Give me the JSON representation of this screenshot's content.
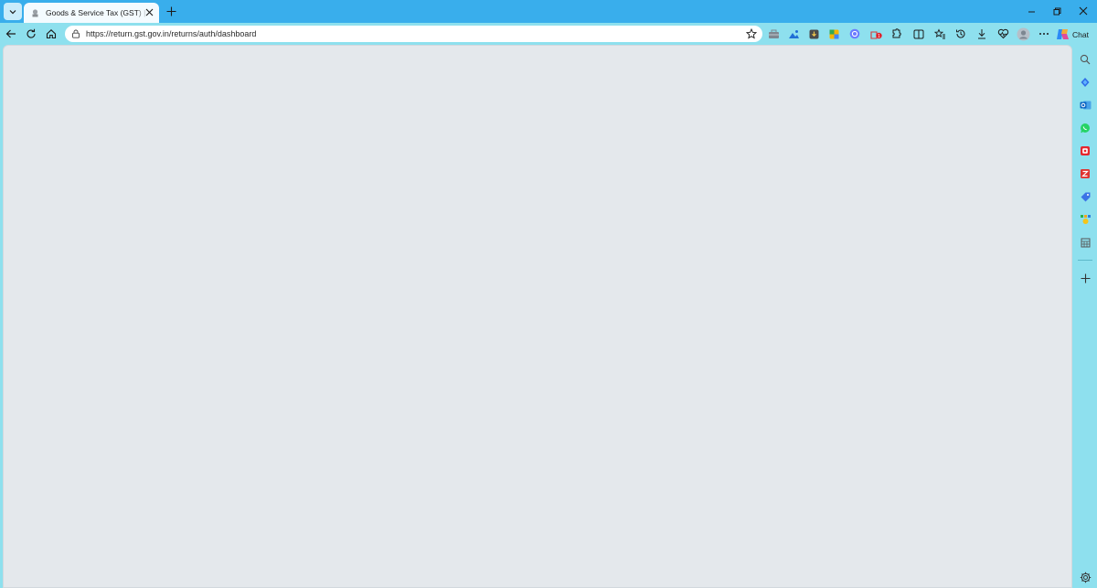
{
  "browser": {
    "tab": {
      "title": "Goods & Service Tax (GST) | User D",
      "favicon": "emblem-icon"
    },
    "address_bar": {
      "url": "https://return.gst.gov.in/returns/auth/dashboard"
    },
    "chat_label": "Chat",
    "toolbar_icons": [
      "star-icon",
      "toolbox-icon",
      "photos-icon",
      "download-ext-icon",
      "wallet-ext-icon",
      "copilot-ext-icon",
      "shopping-badge-icon",
      "extensions-icon",
      "split-screen-icon",
      "favorites-icon",
      "history-icon",
      "downloads-icon",
      "performance-icon",
      "profile-icon",
      "more-icon"
    ],
    "sidebar_icons": [
      "search-icon",
      "copilot-icon",
      "outlook-icon",
      "whatsapp-icon",
      "office-icon",
      "zoho-icon",
      "tag-icon",
      "game-icon",
      "calculator-icon",
      "add-icon",
      "settings-icon"
    ],
    "colors": {
      "titlebar": "#39aeec",
      "toolbar": "#8ee0ee",
      "content": "#e4e8ec"
    }
  }
}
